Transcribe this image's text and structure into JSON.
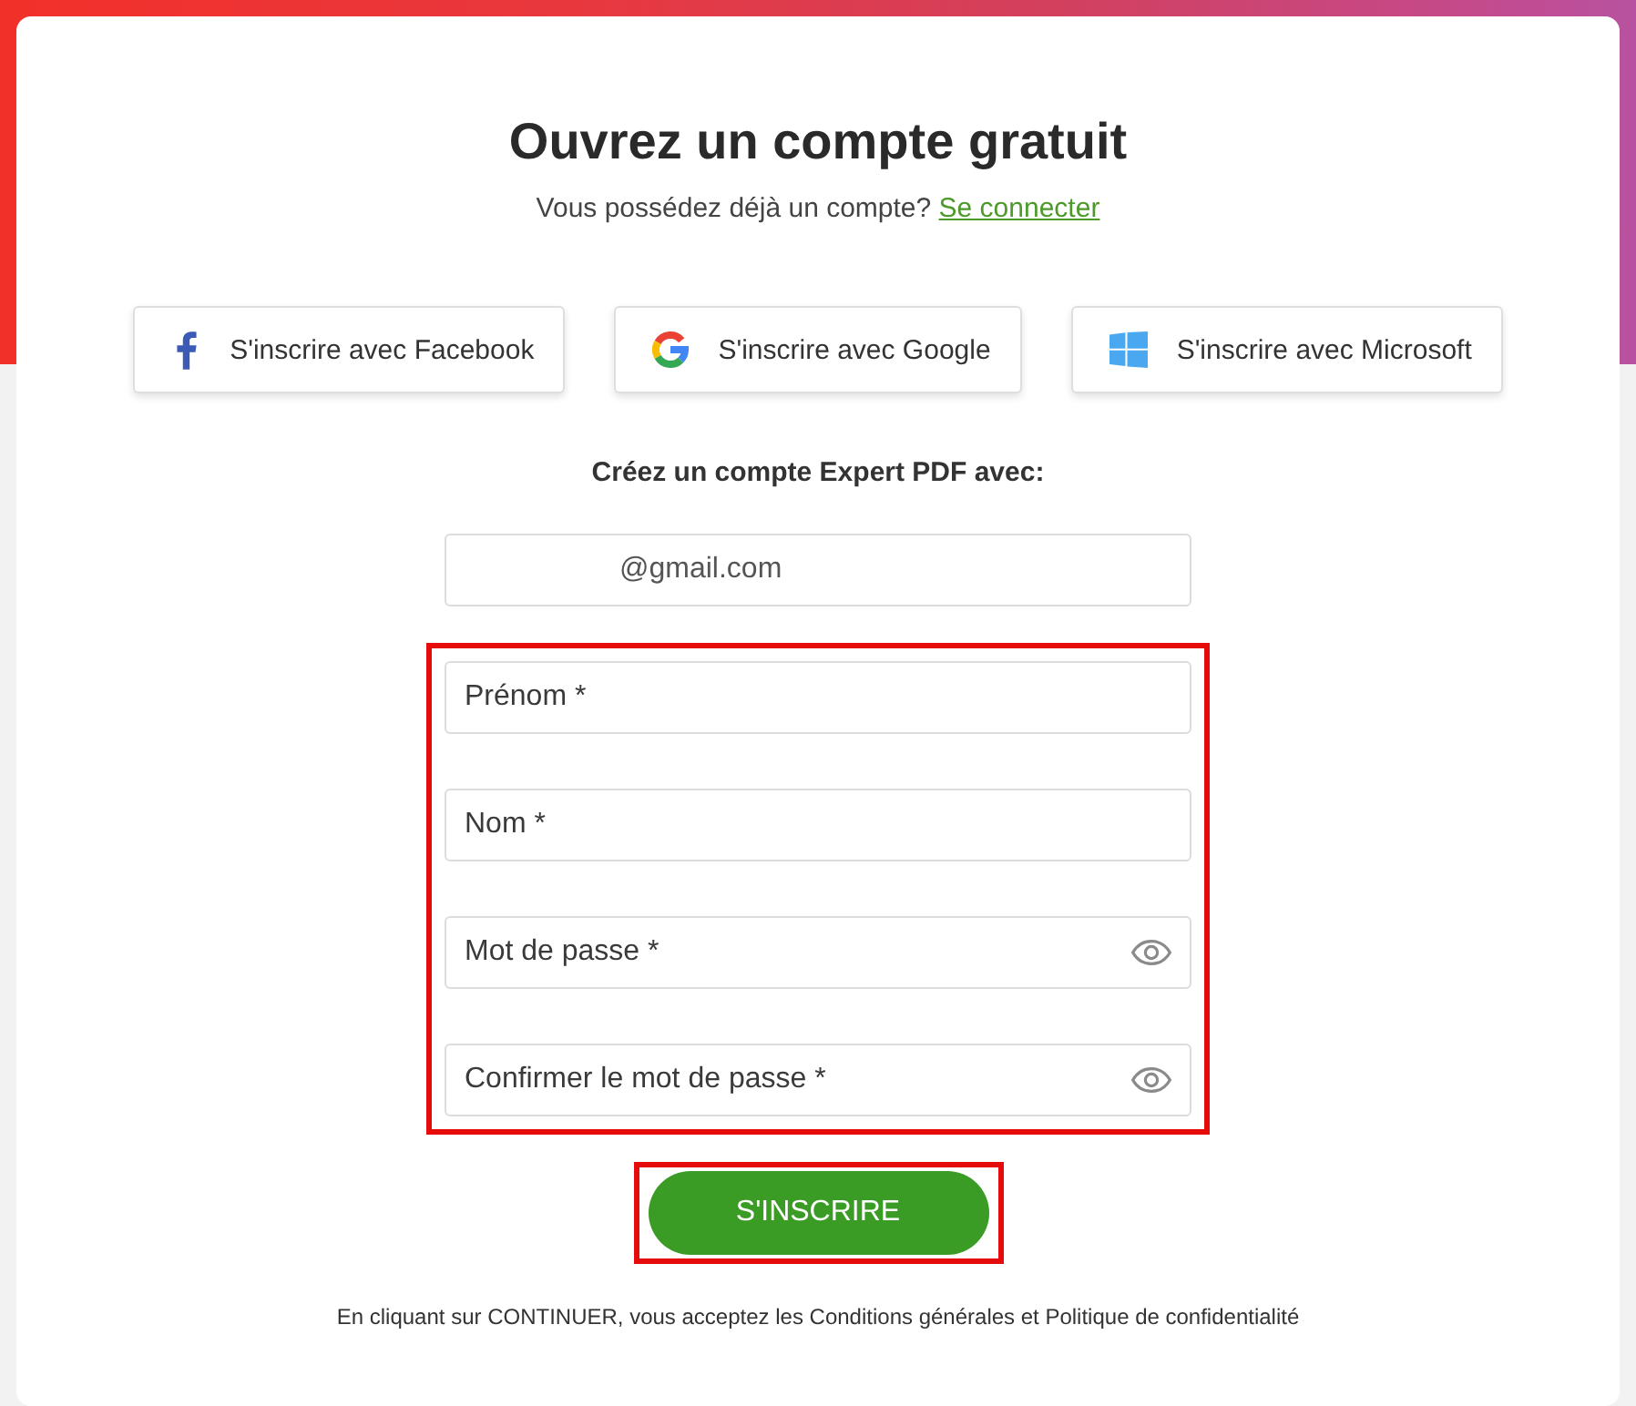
{
  "heading": {
    "title": "Ouvrez un compte gratuit",
    "prompt": "Vous possédez déjà un compte?",
    "login_link": "Se connecter"
  },
  "social_buttons": [
    {
      "kind": "facebook",
      "label": "S'inscrire avec Facebook"
    },
    {
      "kind": "google",
      "label": "S'inscrire avec Google"
    },
    {
      "kind": "microsoft",
      "label": "S'inscrire avec Microsoft"
    }
  ],
  "form": {
    "intro": "Créez un compte Expert PDF avec:",
    "email": {
      "value": "@gmail.com"
    },
    "highlighted": true,
    "fields": [
      {
        "kind": "text",
        "placeholder": "Prénom *"
      },
      {
        "kind": "text",
        "placeholder": "Nom *"
      },
      {
        "kind": "password",
        "placeholder": "Mot de passe *"
      },
      {
        "kind": "password",
        "placeholder": "Confirmer le mot de passe *"
      }
    ]
  },
  "submit": {
    "label": "S'INSCRIRE",
    "highlighted": true
  },
  "legal_note": "En cliquant sur CONTINUER, vous acceptez les Conditions générales et Politique de confidentialité"
}
